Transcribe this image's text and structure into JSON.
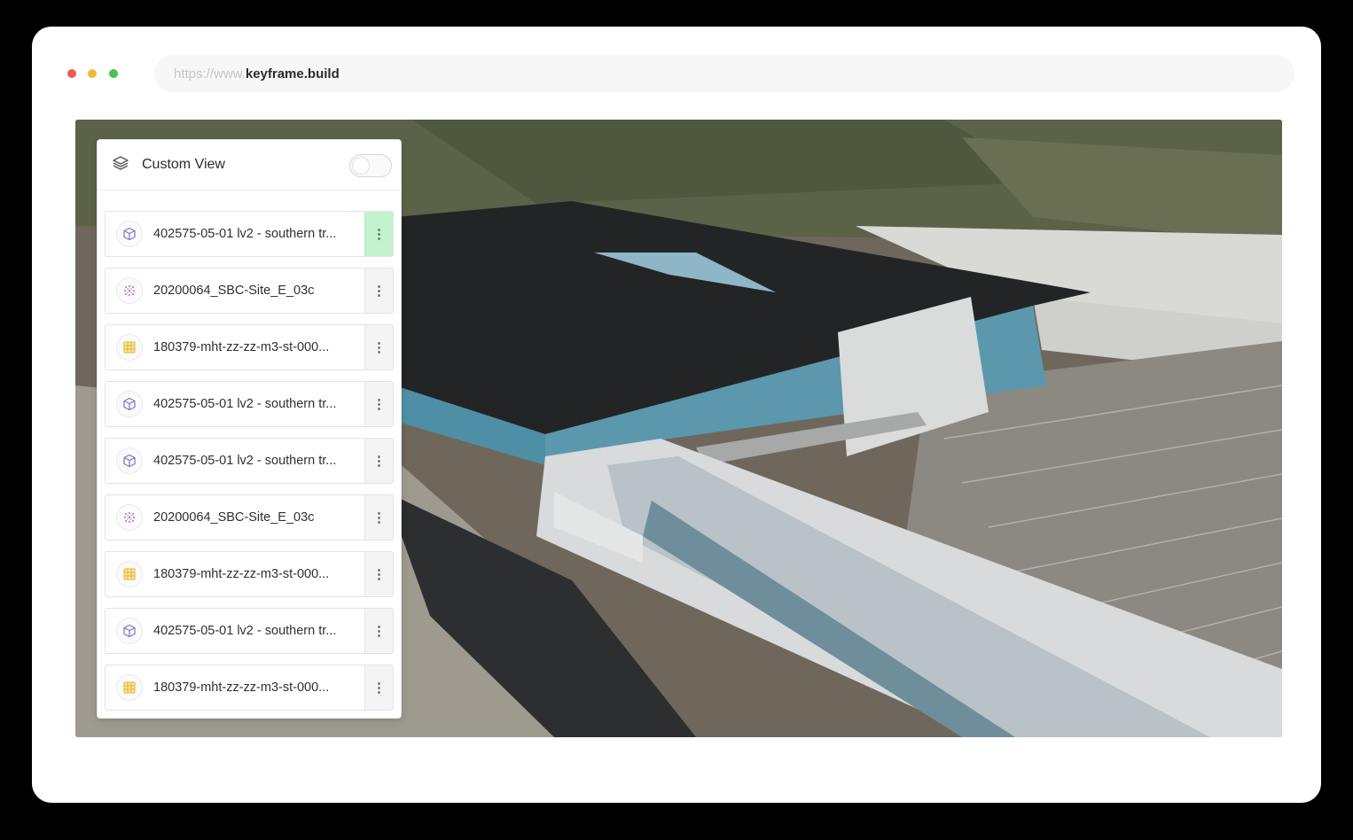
{
  "browser": {
    "url_prefix": "https://www.",
    "url_domain": "keyframe.build"
  },
  "panel": {
    "title": "Custom View",
    "toggle_on": false,
    "layers": [
      {
        "name": "402575-05-01 lv2 - southern tr...",
        "icon": "cube-icon",
        "menu_active": true
      },
      {
        "name": "20200064_SBC-Site_E_03c",
        "icon": "point-cloud-icon",
        "menu_active": false
      },
      {
        "name": "180379-mht-zz-zz-m3-st-000...",
        "icon": "grid-icon",
        "menu_active": false
      },
      {
        "name": "402575-05-01 lv2 - southern tr...",
        "icon": "cube-icon",
        "menu_active": false
      },
      {
        "name": "402575-05-01 lv2 - southern tr...",
        "icon": "cube-icon",
        "menu_active": false
      },
      {
        "name": "20200064_SBC-Site_E_03c",
        "icon": "point-cloud-icon",
        "menu_active": false
      },
      {
        "name": "180379-mht-zz-zz-m3-st-000...",
        "icon": "grid-icon",
        "menu_active": false
      },
      {
        "name": "402575-05-01 lv2 - southern tr...",
        "icon": "cube-icon",
        "menu_active": false
      },
      {
        "name": "180379-mht-zz-zz-m3-st-000...",
        "icon": "grid-icon",
        "menu_active": false
      }
    ]
  },
  "colors": {
    "active_menu": "#c3f2cf",
    "cube_icon": "#7b74c9",
    "point_cloud_icon": "#b765c9",
    "grid_icon": "#e5b63a"
  }
}
